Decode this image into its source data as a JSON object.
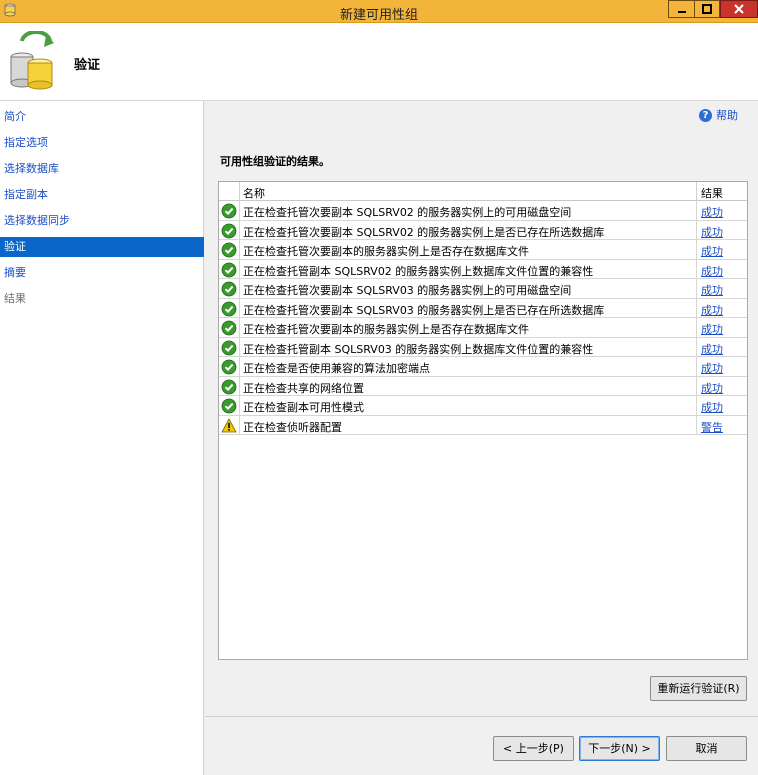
{
  "window": {
    "title": "新建可用性组"
  },
  "header": {
    "title": "验证"
  },
  "sidebar": {
    "items": [
      {
        "label": "简介",
        "state": "link"
      },
      {
        "label": "指定选项",
        "state": "link"
      },
      {
        "label": "选择数据库",
        "state": "link"
      },
      {
        "label": "指定副本",
        "state": "link"
      },
      {
        "label": "选择数据同步",
        "state": "link"
      },
      {
        "label": "验证",
        "state": "active"
      },
      {
        "label": "摘要",
        "state": "link"
      },
      {
        "label": "结果",
        "state": "disabled"
      }
    ]
  },
  "main": {
    "help_label": "帮助",
    "results_heading": "可用性组验证的结果。",
    "columns": {
      "name": "名称",
      "result": "结果"
    },
    "rows": [
      {
        "status": "success",
        "name": "正在检查托管次要副本 SQLSRV02 的服务器实例上的可用磁盘空间",
        "result": "成功"
      },
      {
        "status": "success",
        "name": "正在检查托管次要副本 SQLSRV02 的服务器实例上是否已存在所选数据库",
        "result": "成功"
      },
      {
        "status": "success",
        "name": "正在检查托管次要副本的服务器实例上是否存在数据库文件",
        "result": "成功"
      },
      {
        "status": "success",
        "name": "正在检查托管副本 SQLSRV02 的服务器实例上数据库文件位置的兼容性",
        "result": "成功"
      },
      {
        "status": "success",
        "name": "正在检查托管次要副本 SQLSRV03 的服务器实例上的可用磁盘空间",
        "result": "成功"
      },
      {
        "status": "success",
        "name": "正在检查托管次要副本 SQLSRV03 的服务器实例上是否已存在所选数据库",
        "result": "成功"
      },
      {
        "status": "success",
        "name": "正在检查托管次要副本的服务器实例上是否存在数据库文件",
        "result": "成功"
      },
      {
        "status": "success",
        "name": "正在检查托管副本 SQLSRV03 的服务器实例上数据库文件位置的兼容性",
        "result": "成功"
      },
      {
        "status": "success",
        "name": "正在检查是否使用兼容的算法加密端点",
        "result": "成功"
      },
      {
        "status": "success",
        "name": "正在检查共享的网络位置",
        "result": "成功"
      },
      {
        "status": "success",
        "name": "正在检查副本可用性模式",
        "result": "成功"
      },
      {
        "status": "warning",
        "name": "正在检查侦听器配置",
        "result": "警告"
      }
    ],
    "rerun_button": "重新运行验证(R)"
  },
  "footer": {
    "prev_button": "< 上一步(P)",
    "next_button": "下一步(N) >",
    "cancel_button": "取消"
  },
  "colors": {
    "titlebar": "#f3b43a",
    "close_button": "#c7342c",
    "nav_active": "#0a66c9",
    "link": "#1a4ec8",
    "success_icon": "#3a9a2e",
    "warning_icon": "#f2c600"
  },
  "icons": {
    "app": "database-app-icon",
    "header": "database-sync-icon",
    "success": "check-circle-icon",
    "warning": "warning-triangle-icon",
    "help": "help-circle-icon"
  }
}
